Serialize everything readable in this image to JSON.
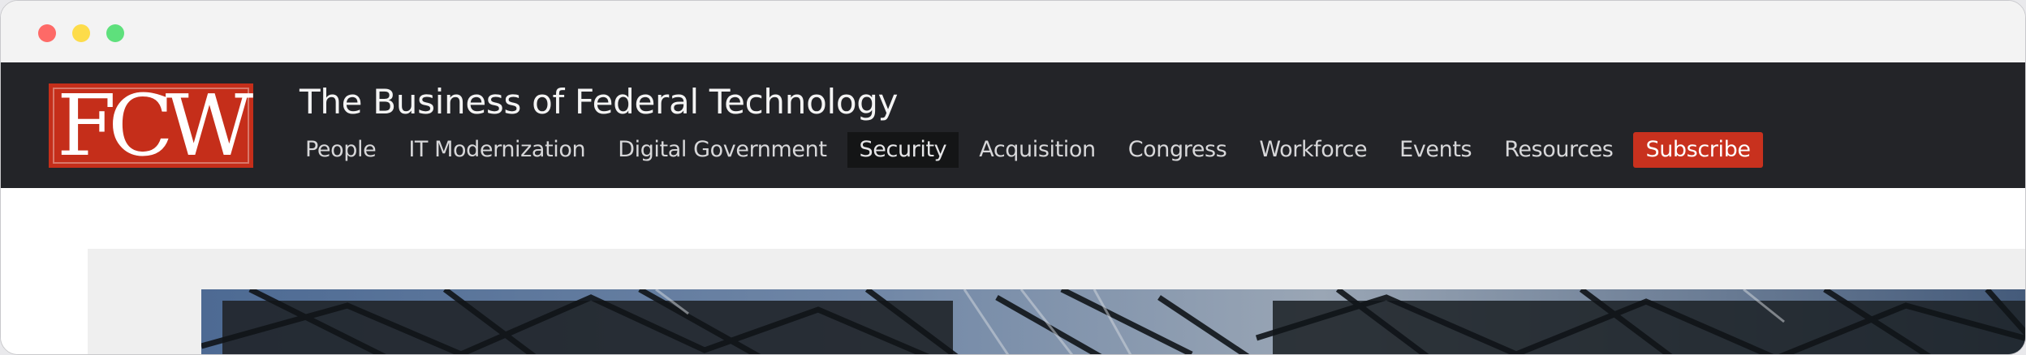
{
  "site": {
    "logo_text": "FCW",
    "tagline": "The Business of Federal Technology",
    "colors": {
      "brand_red": "#c52e1a",
      "header_bg": "#232428",
      "active_nav_bg": "#141516"
    }
  },
  "nav": {
    "items": [
      {
        "label": "People"
      },
      {
        "label": "IT Modernization"
      },
      {
        "label": "Digital Government"
      },
      {
        "label": "Security",
        "active": true
      },
      {
        "label": "Acquisition"
      },
      {
        "label": "Congress"
      },
      {
        "label": "Workforce"
      },
      {
        "label": "Events"
      },
      {
        "label": "Resources"
      },
      {
        "label": "Subscribe"
      }
    ]
  },
  "window": {
    "controls": [
      "close-icon",
      "minimize-icon",
      "maximize-icon"
    ]
  },
  "hero": {
    "image": "steel lattice architecture photo"
  }
}
